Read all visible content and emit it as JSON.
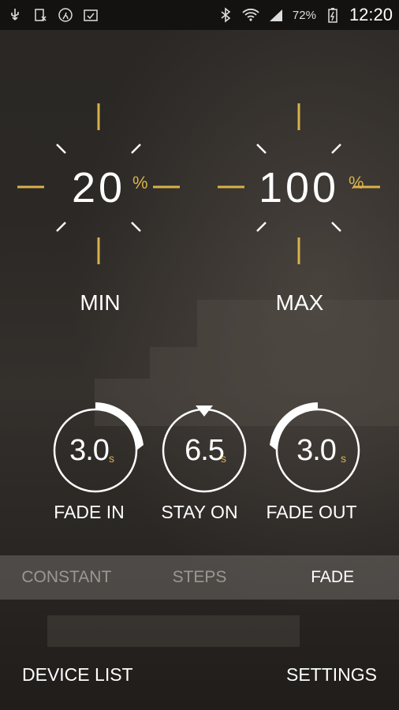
{
  "status_bar": {
    "left_icons": [
      "usb-icon",
      "no-sim-icon",
      "activity-icon",
      "clipboard-icon"
    ],
    "right_icons": [
      "bluetooth-icon",
      "wifi-icon",
      "signal-icon"
    ],
    "battery": "72%",
    "time": "12:20"
  },
  "levels": {
    "min": {
      "value": "20",
      "unit": "%",
      "label": "MIN"
    },
    "max": {
      "value": "100",
      "unit": "%",
      "label": "MAX"
    }
  },
  "timers": [
    {
      "value": "3.0",
      "unit": "s",
      "label": "FADE IN"
    },
    {
      "value": "6.5",
      "unit": "s",
      "label": "STAY ON"
    },
    {
      "value": "3.0",
      "unit": "s",
      "label": "FADE OUT"
    }
  ],
  "modes": {
    "items": [
      "CONSTANT",
      "STEPS",
      "FADE"
    ],
    "selected": "FADE"
  },
  "footer": {
    "left": "DEVICE LIST",
    "right": "SETTINGS"
  },
  "colors": {
    "accent": "#d8b24a",
    "text": "#ffffff",
    "inactive_mode": "#9b9894"
  }
}
